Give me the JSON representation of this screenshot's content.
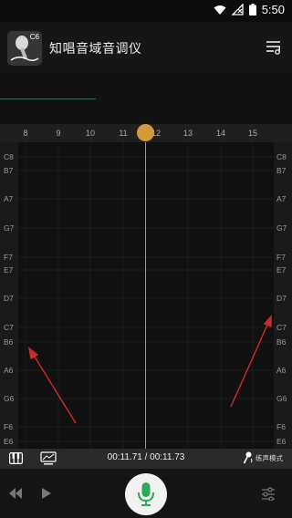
{
  "status_bar": {
    "time": "5:50",
    "icons": [
      "wifi-icon",
      "signal-blocked-icon",
      "battery-icon"
    ]
  },
  "app_bar": {
    "title": "知唱音域音调仪",
    "icon_text": "C6"
  },
  "ruler": {
    "ticks": [
      "8",
      "9",
      "10",
      "11",
      "12",
      "13",
      "14",
      "15"
    ]
  },
  "notes_left": [
    "C8",
    "B7",
    "A7",
    "G7",
    "F7",
    "E7",
    "D7",
    "C7",
    "B6",
    "A6",
    "G6",
    "F6",
    "E6"
  ],
  "notes_right": [
    "C8",
    "B7",
    "A7",
    "G7",
    "F7",
    "E7",
    "D7",
    "C7",
    "B6",
    "A6",
    "G6",
    "F6",
    "E6"
  ],
  "playback": {
    "time_readout": "00:11.71 / 00:11.73",
    "mode_label": "练声模式"
  },
  "colors": {
    "accent_orange": "#d39a3a",
    "mic_green": "#2fa85a",
    "annotation_red": "#d0282c"
  }
}
